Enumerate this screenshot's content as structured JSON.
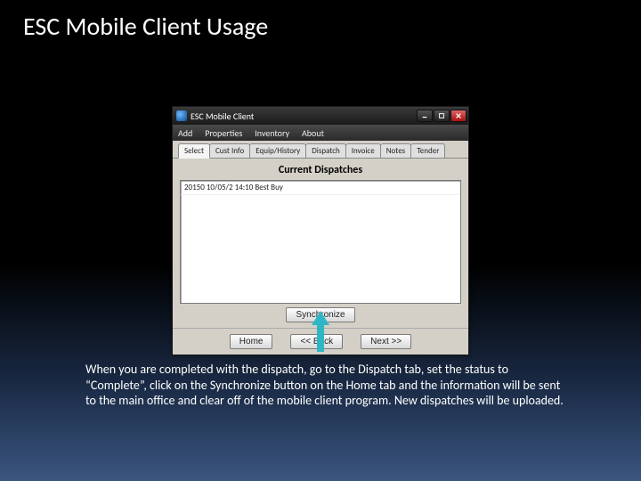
{
  "slide": {
    "title": "ESC Mobile Client Usage",
    "caption": "When you are completed with the dispatch, go to the Dispatch tab, set the status to “Complete”, click on the Synchronize button on the Home tab and the information will be sent to the main office and clear off of the mobile client program. New dispatches will be uploaded."
  },
  "window": {
    "title": "ESC Mobile Client",
    "menu": [
      "Add",
      "Properties",
      "Inventory",
      "About"
    ],
    "tabs": [
      "Select",
      "Cust Info",
      "Equip/History",
      "Dispatch",
      "Invoice",
      "Notes",
      "Tender"
    ],
    "active_tab_index": 0,
    "content_title": "Current Dispatches",
    "dispatch_rows": [
      "20150 10/05/2 14:10 Best Buy"
    ],
    "buttons": {
      "synchronize": "Synchronize",
      "home": "Home",
      "back": "<< Back",
      "next": "Next >>"
    }
  }
}
